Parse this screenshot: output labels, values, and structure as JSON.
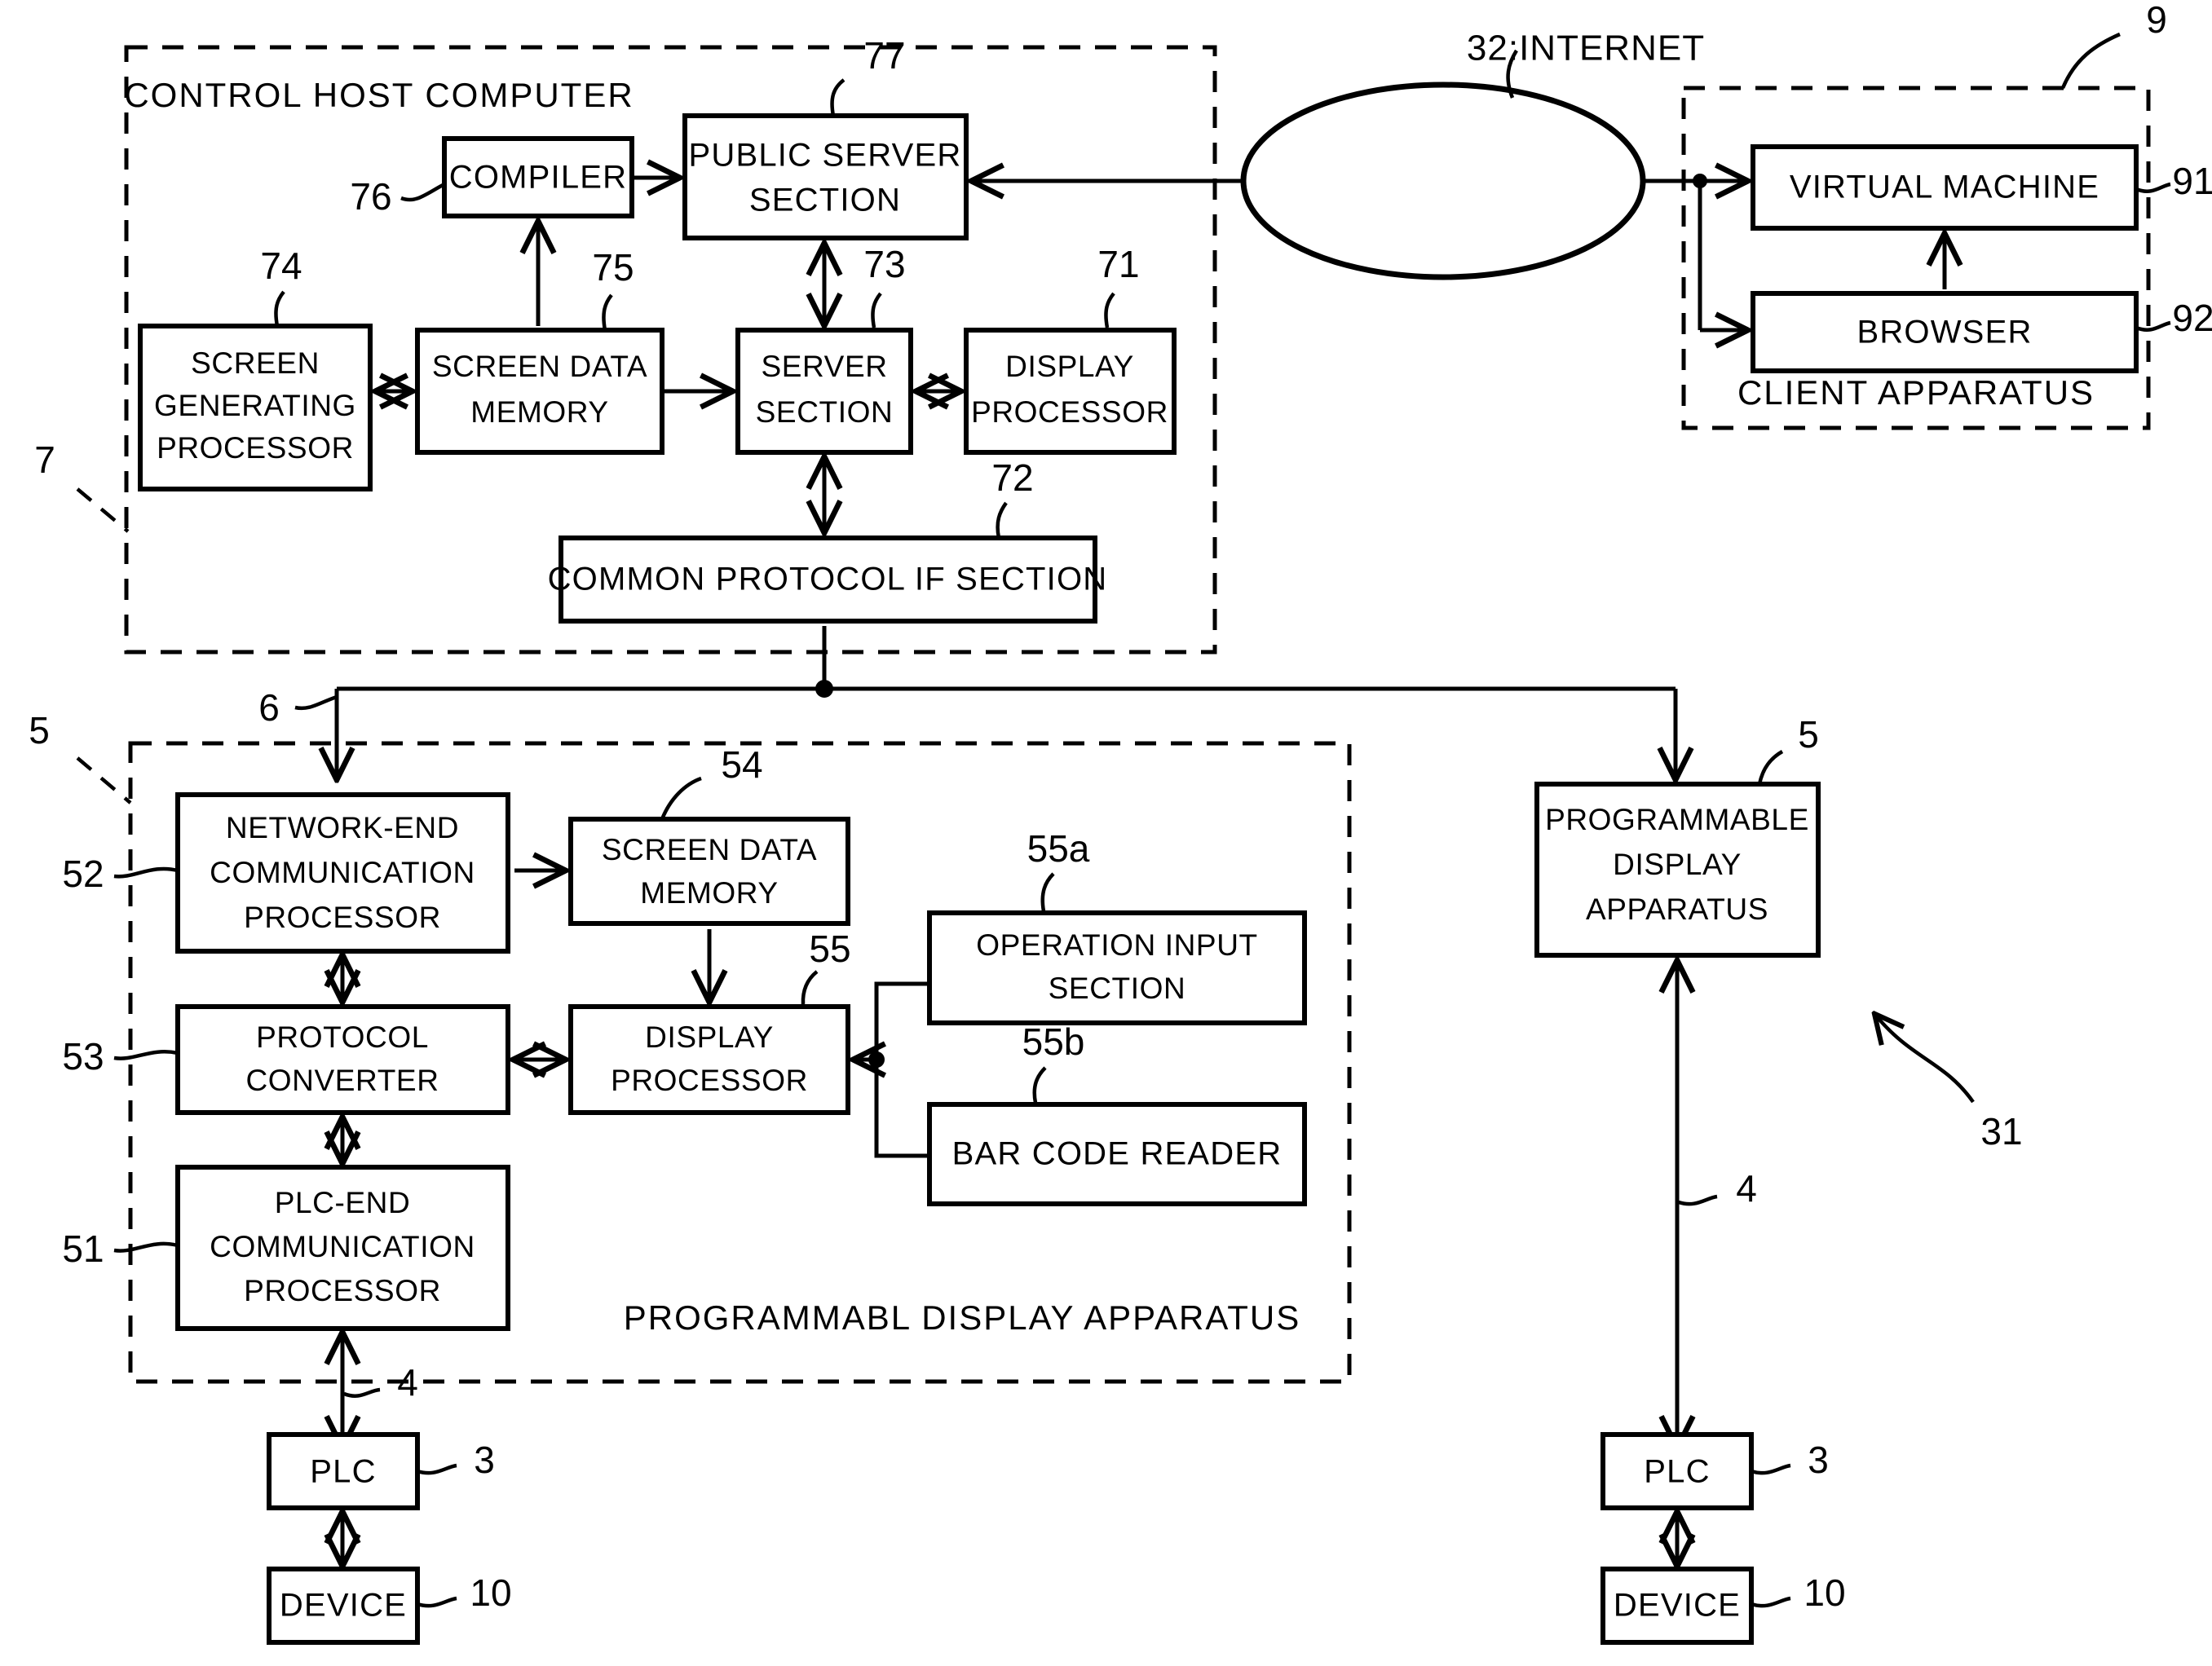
{
  "figure": {
    "title": "Control system block diagram",
    "stroke_color": "#000000",
    "background_color": "#ffffff"
  },
  "regions": [
    {
      "id": "control-host",
      "label": "CONTROL HOST COMPUTER",
      "ref": "7"
    },
    {
      "id": "client-apparatus",
      "label": "CLIENT APPARATUS",
      "ref": "9"
    },
    {
      "id": "programmable-display",
      "label": "PROGRAMMABL DISPLAY  APPARATUS",
      "ref": "5"
    }
  ],
  "network": {
    "cloud_label": "32:INTERNET"
  },
  "blocks": {
    "compiler": {
      "label": "COMPILER",
      "ref": "76"
    },
    "public_server_section": {
      "label_line1": "PUBLIC SERVER",
      "label_line2": "SECTION",
      "ref": "77"
    },
    "screen_generating_processor": {
      "label_line1": "SCREEN",
      "label_line2": "GENERATING",
      "label_line3": "PROCESSOR",
      "ref": "74"
    },
    "screen_data_memory_host": {
      "label_line1": "SCREEN DATA",
      "label_line2": "MEMORY",
      "ref": "75"
    },
    "server_section": {
      "label_line1": "SERVER",
      "label_line2": "SECTION",
      "ref": "73"
    },
    "display_processor_host": {
      "label_line1": "DISPLAY",
      "label_line2": "PROCESSOR",
      "ref": "71"
    },
    "common_protocol_if_section": {
      "label": "COMMON PROTOCOL IF SECTION",
      "ref": "72"
    },
    "virtual_machine": {
      "label": "VIRTUAL MACHINE",
      "ref": "91"
    },
    "browser": {
      "label": "BROWSER",
      "ref": "92"
    },
    "network_end_communication_processor": {
      "label_line1": "NETWORK-END",
      "label_line2": "COMMUNICATION",
      "label_line3": "PROCESSOR",
      "ref": "52"
    },
    "screen_data_memory_pd": {
      "label_line1": "SCREEN DATA",
      "label_line2": "MEMORY",
      "ref": "54"
    },
    "operation_input_section": {
      "label_line1": "OPERATION INPUT",
      "label_line2": "SECTION",
      "ref": "55a"
    },
    "protocol_converter": {
      "label_line1": "PROTOCOL",
      "label_line2": "CONVERTER",
      "ref": "53"
    },
    "display_processor_pd": {
      "label_line1": "DISPLAY",
      "label_line2": "PROCESSOR",
      "ref": "55"
    },
    "bar_code_reader": {
      "label": "BAR CODE READER",
      "ref": "55b"
    },
    "plc_end_communication_processor": {
      "label_line1": "PLC-END",
      "label_line2": "COMMUNICATION",
      "label_line3": "PROCESSOR",
      "ref": "51"
    },
    "programmable_display_apparatus_right": {
      "label_line1": "PROGRAMMABLE",
      "label_line2": "DISPLAY",
      "label_line3": "APPARATUS",
      "ref": "5"
    },
    "plc_left": {
      "label": "PLC",
      "ref": "3"
    },
    "device_left": {
      "label": "DEVICE",
      "ref": "10"
    },
    "plc_right": {
      "label": "PLC",
      "ref": "3"
    },
    "device_right": {
      "label": "DEVICE",
      "ref": "10"
    }
  },
  "link_refs": {
    "bus_network": "6",
    "plc_link_left": "4",
    "plc_link_right": "4",
    "system_ref": "31"
  }
}
